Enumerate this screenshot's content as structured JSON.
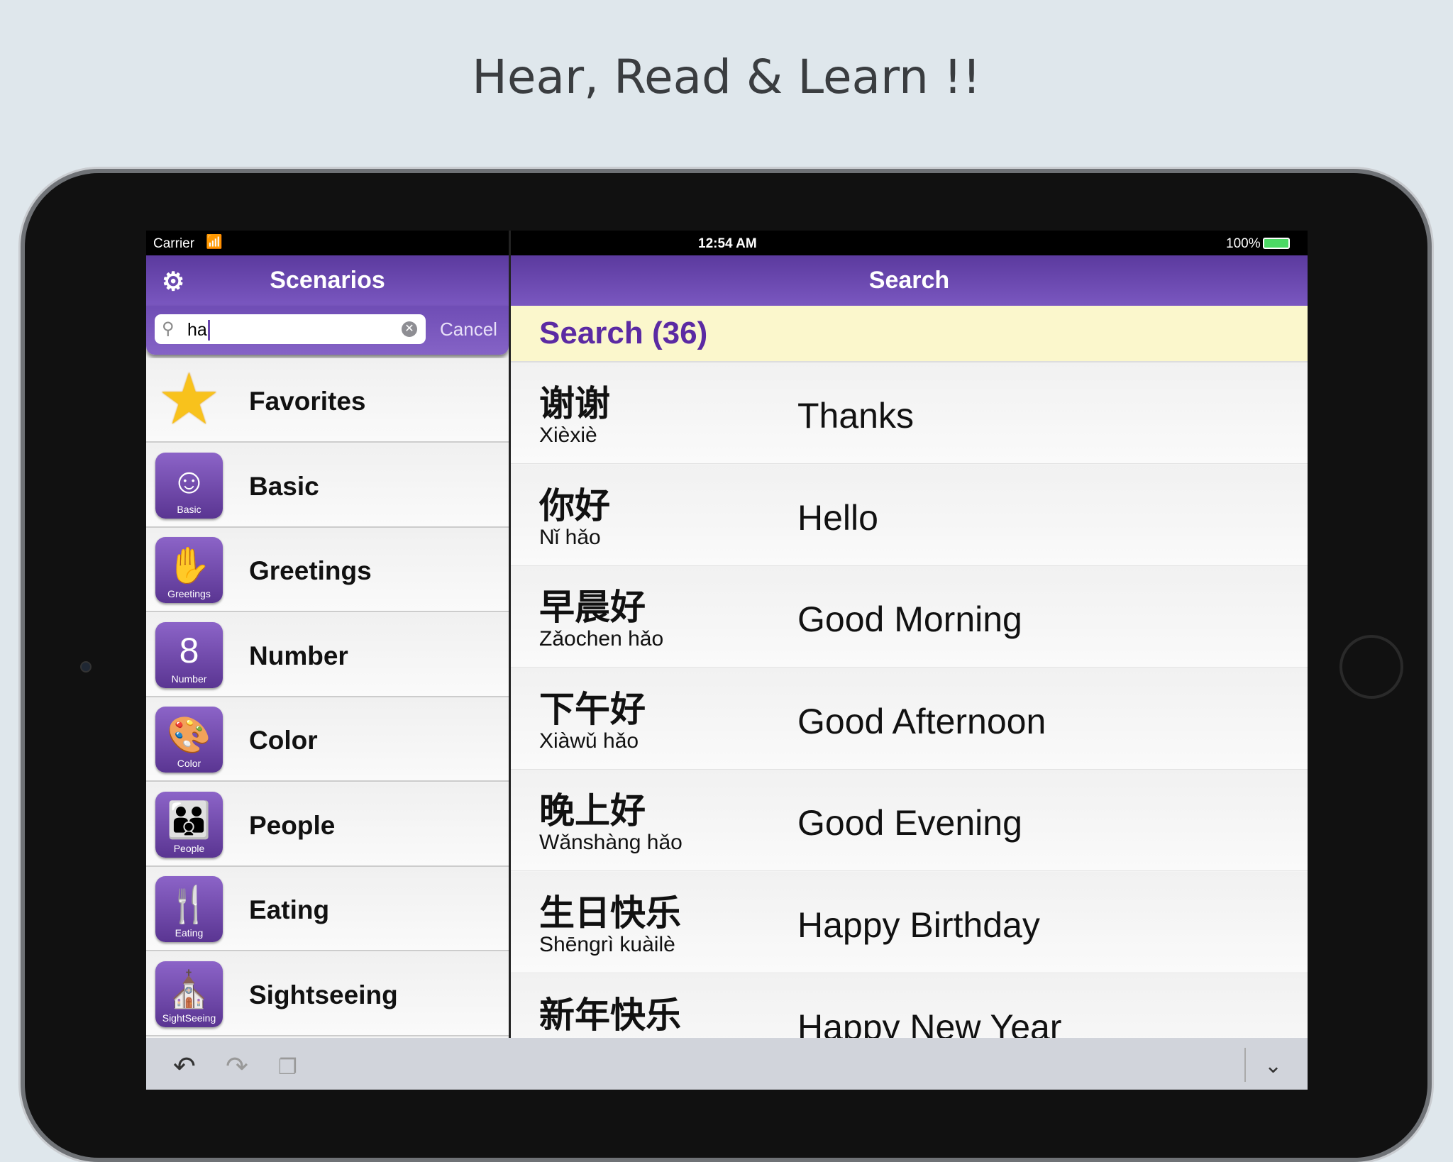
{
  "headline": "Hear, Read & Learn !!",
  "status": {
    "carrier": "Carrier",
    "time": "12:54 AM",
    "battery": "100%"
  },
  "left": {
    "title": "Scenarios",
    "search_value": "ha",
    "cancel": "Cancel",
    "items": [
      {
        "label": "Favorites",
        "icon": "star-icon",
        "badge": ""
      },
      {
        "label": "Basic",
        "icon": "smiley-icon",
        "badge": "Basic"
      },
      {
        "label": "Greetings",
        "icon": "hand-icon",
        "badge": "Greetings"
      },
      {
        "label": "Number",
        "icon": "number-icon",
        "badge": "Number"
      },
      {
        "label": "Color",
        "icon": "palette-icon",
        "badge": "Color"
      },
      {
        "label": "People",
        "icon": "people-icon",
        "badge": "People"
      },
      {
        "label": "Eating",
        "icon": "cutlery-icon",
        "badge": "Eating"
      },
      {
        "label": "Sightseeing",
        "icon": "tower-icon",
        "badge": "SightSeeing"
      }
    ]
  },
  "right": {
    "title": "Search",
    "header": "Search (36)",
    "rows": [
      {
        "cn": "谢谢",
        "py": "Xièxiè",
        "en": "Thanks"
      },
      {
        "cn": "你好",
        "py": "Nǐ hǎo",
        "en": "Hello"
      },
      {
        "cn": "早晨好",
        "py": "Zǎochen hǎo",
        "en": "Good Morning"
      },
      {
        "cn": "下午好",
        "py": "Xiàwǔ hǎo",
        "en": "Good Afternoon"
      },
      {
        "cn": "晚上好",
        "py": "Wǎnshàng hǎo",
        "en": "Good Evening"
      },
      {
        "cn": "生日快乐",
        "py": "Shēngrì kuàilè",
        "en": "Happy Birthday"
      },
      {
        "cn": "新年快乐",
        "py": "",
        "en": "Happy New Year"
      }
    ]
  }
}
